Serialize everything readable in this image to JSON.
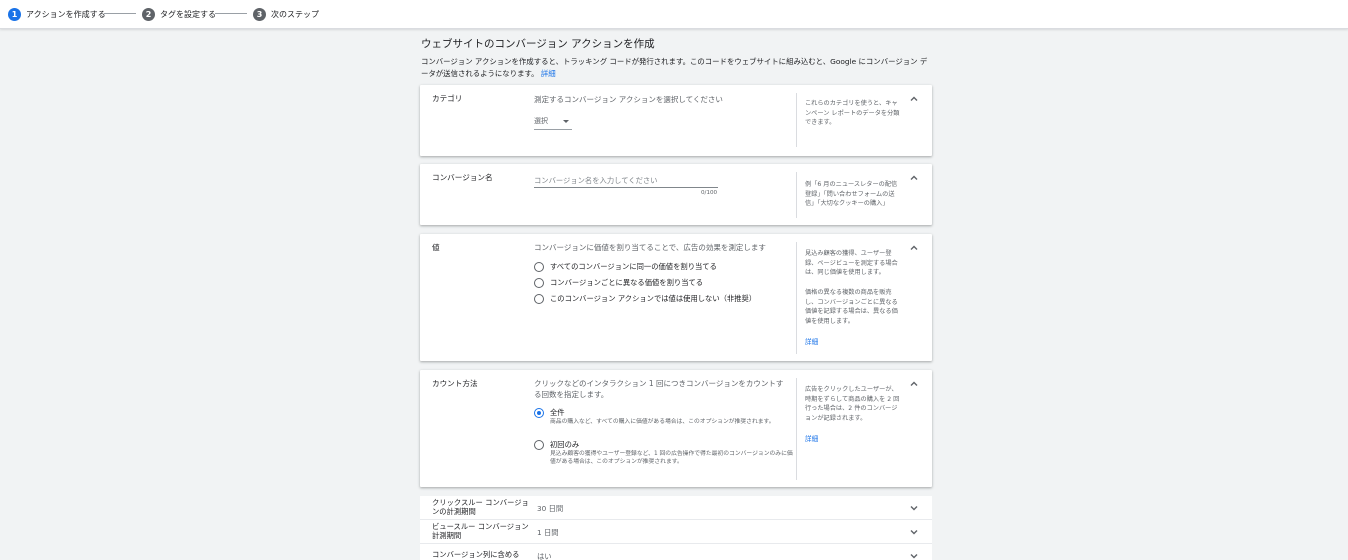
{
  "stepper": {
    "steps": [
      {
        "number": "1",
        "label": "アクションを作成する",
        "active": true
      },
      {
        "number": "2",
        "label": "タグを設定する",
        "active": false
      },
      {
        "number": "3",
        "label": "次のステップ",
        "active": false
      }
    ]
  },
  "page": {
    "title": "ウェブサイトのコンバージョン アクションを作成",
    "description": "コンバージョン アクションを作成すると、トラッキング コードが発行されます。このコードをウェブサイトに組み込むと、Google にコンバージョン データが送信されるようになります。",
    "details_link": "詳細"
  },
  "category": {
    "label": "カテゴリ",
    "prompt": "測定するコンバージョン アクションを選択してください",
    "select_value": "選択",
    "help": "これらのカテゴリを使うと、キャンペーン レポートのデータを分類できます。"
  },
  "conversion_name": {
    "label": "コンバージョン名",
    "placeholder": "コンバージョン名を入力してください",
    "value": "",
    "counter": "0/100",
    "help": "例「6 月のニュースレターの配信登録」「問い合わせフォームの送信」「大切なクッキーの購入」"
  },
  "value": {
    "label": "値",
    "prompt": "コンバージョンに価値を割り当てることで、広告の効果を測定します",
    "options": [
      {
        "label": "すべてのコンバージョンに同一の価値を割り当てる",
        "checked": false
      },
      {
        "label": "コンバージョンごとに異なる価値を割り当てる",
        "checked": false
      },
      {
        "label": "このコンバージョン アクションでは値は使用しない（非推奨）",
        "checked": false
      }
    ],
    "help1": "見込み顧客の獲得、ユーザー登録、ページビューを測定する場合は、同じ価値を使用します。",
    "help2": "価格の異なる複数の商品を販売し、コンバージョンごとに異なる価値を記録する場合は、異なる価値を使用します。",
    "help_link": "詳細"
  },
  "count": {
    "label": "カウント方法",
    "prompt": "クリックなどのインタラクション 1 回につきコンバージョンをカウントする回数を指定します。",
    "options": [
      {
        "label": "全件",
        "sub": "商品の購入など、すべての購入に価値がある場合は、このオプションが推奨されます。",
        "checked": true
      },
      {
        "label": "初回のみ",
        "sub": "見込み顧客の獲得やユーザー登録など、1 回の広告操作で得た最初のコンバージョンのみに価値がある場合は、このオプションが推奨されます。",
        "checked": false
      }
    ],
    "help": "広告をクリックしたユーザーが、時期をずらして商品の購入を 2 回行った場合は、2 件のコンバージョンが記録されます。",
    "help_link": "詳細"
  },
  "collapsed_rows": [
    {
      "label": "クリックスルー コンバージョンの計測期間",
      "value": "30 日間"
    },
    {
      "label": "ビュースルー コンバージョン計測期間",
      "value": "1 日間"
    },
    {
      "label": "コンバージョン列に含める",
      "value": "はい"
    }
  ],
  "colors": {
    "accent": "#1a73e8",
    "background": "#f1f3f4",
    "card": "#ffffff"
  }
}
